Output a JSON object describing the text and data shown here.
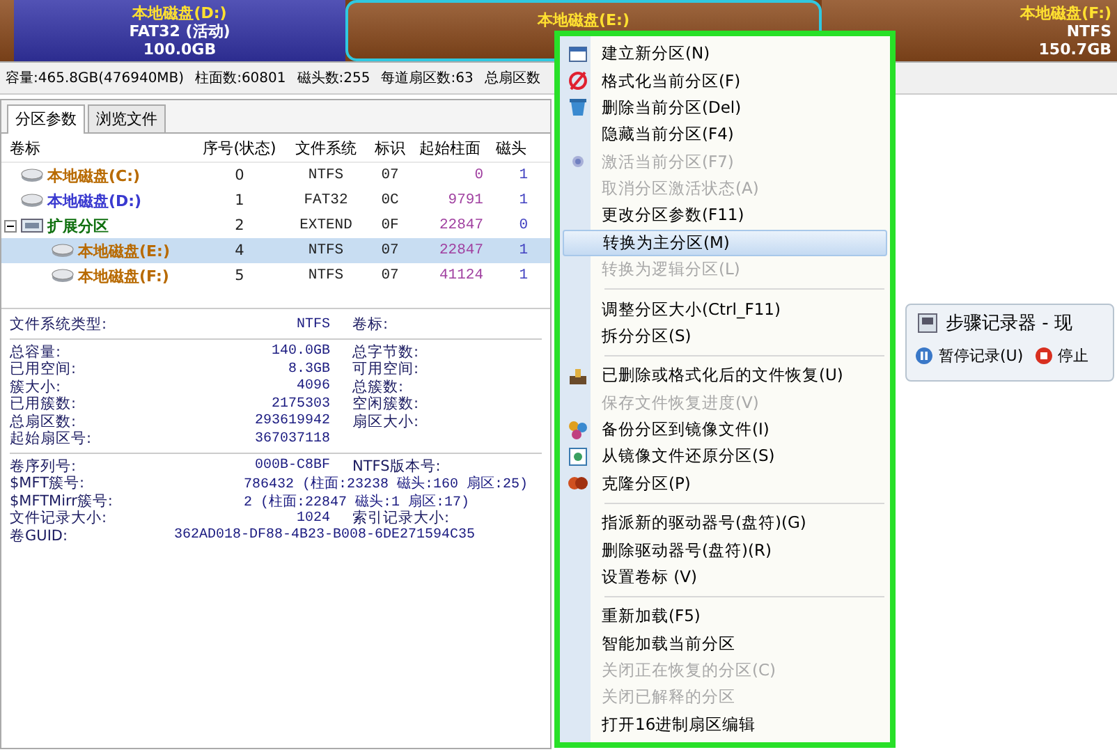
{
  "disk_bar": {
    "segments": [
      {
        "kind": "sliver",
        "selected": false,
        "color": "#8b4a1c"
      },
      {
        "kind": "partition",
        "selected": false,
        "color": "#3434a8",
        "lines": [
          "本地磁盘(D:)",
          "FAT32 (活动)",
          "100.0GB"
        ]
      },
      {
        "kind": "partition",
        "selected": true,
        "color": "#8b4a1c",
        "lines": [
          "本地磁盘(E:)"
        ]
      },
      {
        "kind": "partition",
        "selected": false,
        "color": "#8b4a1c",
        "lines": [
          "本地磁盘(F:)",
          "NTFS",
          "150.7GB"
        ]
      }
    ]
  },
  "disk_info": [
    "容量:465.8GB(476940MB)",
    "柱面数:60801",
    "磁头数:255",
    "每道扇区数:63",
    "总扇区数"
  ],
  "tabs": [
    {
      "label": "分区参数",
      "selected": true
    },
    {
      "label": "浏览文件",
      "selected": false
    }
  ],
  "table": {
    "columns": [
      "卷标",
      "序号(状态)",
      "文件系统",
      "标识",
      "起始柱面",
      "磁头"
    ],
    "rows": [
      {
        "name": "本地磁盘(C:)",
        "color": "#b86a00",
        "index": "0",
        "fs": "NTFS",
        "id": "07",
        "cylinder": "0",
        "head": "1",
        "selected": false
      },
      {
        "name": "本地磁盘(D:)",
        "color": "#3a3ad0",
        "index": "1",
        "fs": "FAT32",
        "id": "0C",
        "cylinder": "9791",
        "head": "1",
        "selected": false
      },
      {
        "name": "扩展分区",
        "color": "#107010",
        "index": "2",
        "fs": "EXTEND",
        "id": "0F",
        "cylinder": "22847",
        "head": "0",
        "selected": false,
        "expanded": true,
        "children": [
          {
            "name": "本地磁盘(E:)",
            "color": "#b86a00",
            "index": "4",
            "fs": "NTFS",
            "id": "07",
            "cylinder": "22847",
            "head": "1",
            "selected": true
          },
          {
            "name": "本地磁盘(F:)",
            "color": "#b86a00",
            "index": "5",
            "fs": "NTFS",
            "id": "07",
            "cylinder": "41124",
            "head": "1",
            "selected": false
          }
        ]
      }
    ]
  },
  "details": {
    "sections": [
      [
        {
          "label": "文件系统类型:",
          "value": "NTFS",
          "label2": "卷标:"
        }
      ],
      [
        {
          "label": "总容量:",
          "value": "140.0GB",
          "label2": "总字节数:"
        },
        {
          "label": "已用空间:",
          "value": "8.3GB",
          "label2": "可用空间:"
        },
        {
          "label": "簇大小:",
          "value": "4096",
          "label2": "总簇数:"
        },
        {
          "label": "已用簇数:",
          "value": "2175303",
          "label2": "空闲簇数:"
        },
        {
          "label": "总扇区数:",
          "value": "293619942",
          "label2": "扇区大小:"
        },
        {
          "label": "起始扇区号:",
          "value": "367037118"
        }
      ],
      [
        {
          "label": "卷序列号:",
          "value": "000B-C8BF",
          "label2": "NTFS版本号:"
        },
        {
          "label": "$MFT簇号:",
          "value": "786432 (柱面:23238 磁头:160 扇区:25)",
          "kind": "wide"
        },
        {
          "label": "$MFTMirr簇号:",
          "value": "2 (柱面:22847 磁头:1 扇区:17)",
          "kind": "wide"
        },
        {
          "label": "文件记录大小:",
          "value": "1024",
          "label2": "索引记录大小:"
        },
        {
          "label": "卷GUID:",
          "value": "362AD018-DF88-4B23-B008-6DE271594C35",
          "kind": "guid"
        }
      ]
    ]
  },
  "context_menu": {
    "items": [
      {
        "kind": "item",
        "label": "建立新分区(N)",
        "disabled": false,
        "selected": false
      },
      {
        "kind": "item",
        "label": "格式化当前分区(F)",
        "disabled": false,
        "selected": false
      },
      {
        "kind": "item",
        "label": "删除当前分区(Del)",
        "disabled": false,
        "selected": false
      },
      {
        "kind": "item",
        "label": "隐藏当前分区(F4)",
        "disabled": false,
        "selected": false
      },
      {
        "kind": "item",
        "label": "激活当前分区(F7)",
        "disabled": true,
        "selected": false
      },
      {
        "kind": "item",
        "label": "取消分区激活状态(A)",
        "disabled": true,
        "selected": false
      },
      {
        "kind": "item",
        "label": "更改分区参数(F11)",
        "disabled": false,
        "selected": false
      },
      {
        "kind": "item",
        "label": "转换为主分区(M)",
        "disabled": false,
        "selected": true
      },
      {
        "kind": "item",
        "label": "转换为逻辑分区(L)",
        "disabled": true,
        "selected": false
      },
      {
        "kind": "separator"
      },
      {
        "kind": "item",
        "label": "调整分区大小(Ctrl_F11)",
        "disabled": false,
        "selected": false
      },
      {
        "kind": "item",
        "label": "拆分分区(S)",
        "disabled": false,
        "selected": false
      },
      {
        "kind": "separator"
      },
      {
        "kind": "item",
        "label": "已删除或格式化后的文件恢复(U)",
        "disabled": false,
        "selected": false
      },
      {
        "kind": "item",
        "label": "保存文件恢复进度(V)",
        "disabled": true,
        "selected": false
      },
      {
        "kind": "item",
        "label": "备份分区到镜像文件(I)",
        "disabled": false,
        "selected": false
      },
      {
        "kind": "item",
        "label": "从镜像文件还原分区(S)",
        "disabled": false,
        "selected": false
      },
      {
        "kind": "item",
        "label": "克隆分区(P)",
        "disabled": false,
        "selected": false
      },
      {
        "kind": "separator"
      },
      {
        "kind": "item",
        "label": "指派新的驱动器号(盘符)(G)",
        "disabled": false,
        "selected": false
      },
      {
        "kind": "item",
        "label": "删除驱动器号(盘符)(R)",
        "disabled": false,
        "selected": false
      },
      {
        "kind": "item",
        "label": "设置卷标 (V)",
        "disabled": false,
        "selected": false
      },
      {
        "kind": "separator"
      },
      {
        "kind": "item",
        "label": "重新加载(F5)",
        "disabled": false,
        "selected": false
      },
      {
        "kind": "item",
        "label": "智能加载当前分区",
        "disabled": false,
        "selected": false
      },
      {
        "kind": "item",
        "label": "关闭正在恢复的分区(C)",
        "disabled": true,
        "selected": false
      },
      {
        "kind": "item",
        "label": "关闭已解释的分区",
        "disabled": true,
        "selected": false
      },
      {
        "kind": "item",
        "label": "打开16进制扇区编辑",
        "disabled": false,
        "selected": false
      }
    ]
  },
  "steps_recorder": {
    "title": "步骤记录器 - 现",
    "buttons": [
      {
        "label": "暂停记录(U)",
        "kind": "pause"
      },
      {
        "label": "停止",
        "kind": "stop"
      }
    ]
  }
}
